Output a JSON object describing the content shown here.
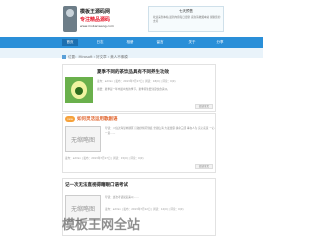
{
  "header": {
    "logo_line1": "模板王源码网",
    "logo_line2": "专注精品源码",
    "logo_line3": "www.mobanwang.com",
    "notice_title": "七天预售",
    "notice_text": "欢迎来到本站 最新内容每日更新 喜欢请收藏本站 谢谢您的支持"
  },
  "nav": {
    "items": [
      "首页",
      "日志",
      "相册",
      "留言",
      "关于",
      "分享"
    ]
  },
  "breadcrumb": {
    "path": "位置：Mirosoft › 好文章 › 美人不像模"
  },
  "articles": [
    {
      "title": "夏季不同的茶饮品具有不同养生功效",
      "meta": "发布：admin | 发布：2013年7月17日 | 阅读：18(0) | 评论：0(0)",
      "excerpt": "摘要：夏季是一年中最炎热的季节，夏季养生要注意饮食清淡。",
      "more": "阅读全文"
    },
    {
      "title": "如何灵活运用歌剧语",
      "badge": "new",
      "meta": "发布：admin | 发布：2013年7月17日 | 阅读：15(0) | 评论：0(0)",
      "excerpt": "导读：八仙过海显神通区 打破砂锅问到底 坐观山海 大发雷霆 拼命三郎 事在人为 实心实意 一心一意……",
      "thumb": "无缩略图",
      "more": "阅读全文"
    },
    {
      "title": "记一次无法直视得瞎眼口语考试",
      "meta": "发布：admin | 发布：2013年7月12日 | 阅读：12(0) | 评论：0(0)",
      "excerpt": "导读：这次考试说起来以……",
      "thumb": "无缩略图"
    }
  ],
  "watermark": "模板王网全站",
  "colors": {
    "nav": "#2a8fd8",
    "brand_red": "#e8192c",
    "badge": "#f6a23b"
  }
}
